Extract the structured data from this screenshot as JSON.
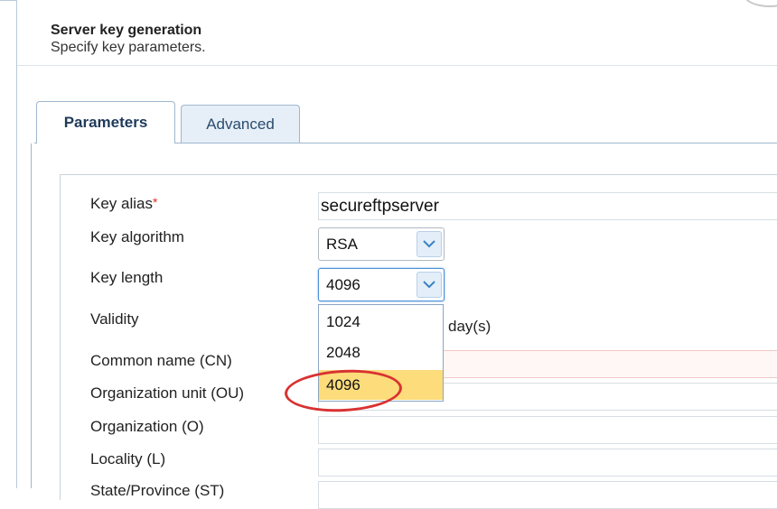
{
  "header": {
    "title": "Server key generation",
    "subtitle": "Specify key parameters."
  },
  "tabs": [
    {
      "label": "Parameters",
      "active": true
    },
    {
      "label": "Advanced",
      "active": false
    }
  ],
  "form": {
    "key_alias": {
      "label": "Key alias",
      "required_mark": "*",
      "value": "secureftpserver"
    },
    "key_algorithm": {
      "label": "Key algorithm",
      "value": "RSA"
    },
    "key_length": {
      "label": "Key length",
      "value": "4096"
    },
    "validity": {
      "label": "Validity",
      "unit": "day(s)"
    },
    "common_name": {
      "label": "Common name (CN)"
    },
    "org_unit": {
      "label": "Organization unit (OU)"
    },
    "organization": {
      "label": "Organization (O)"
    },
    "locality": {
      "label": "Locality (L)"
    },
    "state": {
      "label": "State/Province (ST)"
    }
  },
  "key_length_options": [
    "1024",
    "2048",
    "4096"
  ],
  "selected_option": "4096",
  "colors": {
    "accent_border": "#9fb7cf",
    "selected_option_bg": "#fcdc7b",
    "highlight_circle": "#d93232",
    "required_mark": "#e0302a"
  },
  "icons": {
    "dropdown_chevron": "chevron-down-icon"
  }
}
